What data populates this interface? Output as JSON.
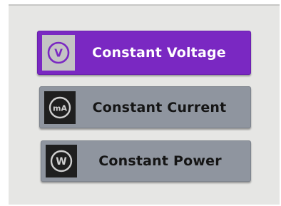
{
  "modes": [
    {
      "label": "Constant Voltage",
      "icon_text": "V",
      "icon": "volt-circle-icon",
      "selected": true
    },
    {
      "label": "Constant Current",
      "icon_text": "mA",
      "icon": "milliamp-circle-icon",
      "selected": false
    },
    {
      "label": "Constant Power",
      "icon_text": "W",
      "icon": "watt-circle-icon",
      "selected": false
    }
  ],
  "colors": {
    "screen_background": "#e6e6e4",
    "selected_button": "#7a28c2",
    "unselected_button": "#8f959f",
    "selected_icon_tile": "#c4c4c4",
    "unselected_icon_tile": "#1f1f1f",
    "selected_icon_glyph": "#7a28c2",
    "unselected_icon_glyph": "#cfcfcf"
  }
}
